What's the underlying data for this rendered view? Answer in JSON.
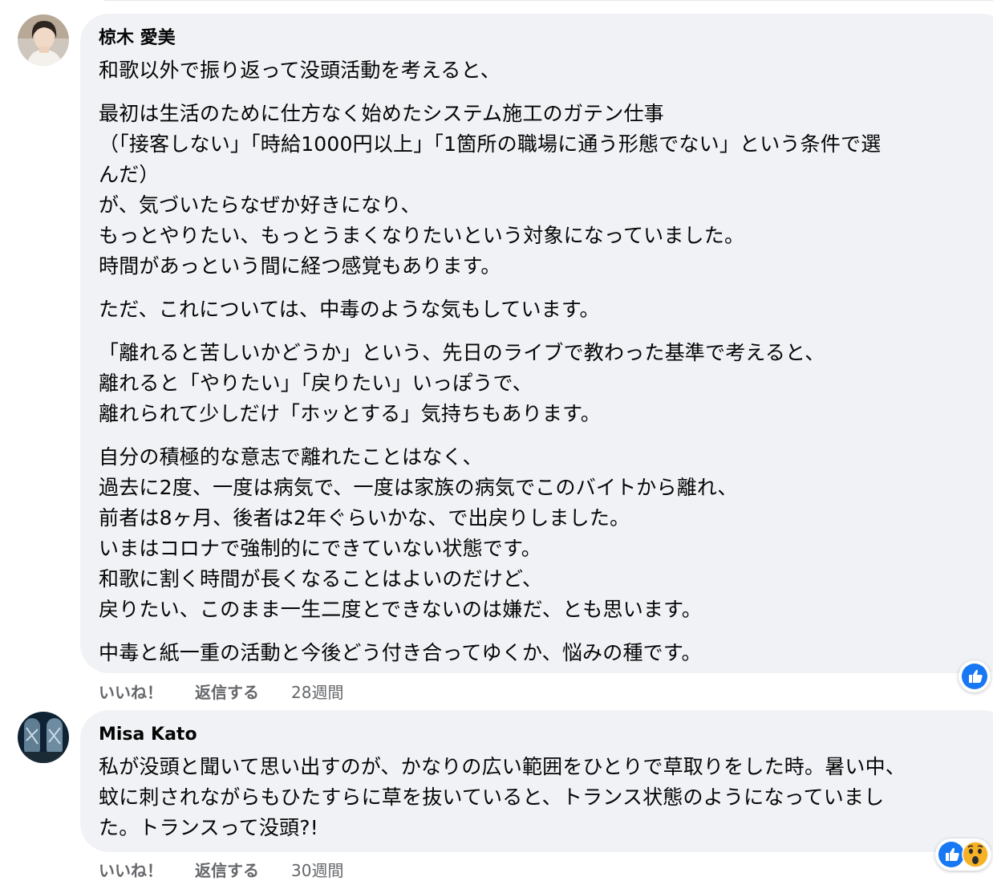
{
  "comments": [
    {
      "author": "椋木 愛美",
      "paragraphs": [
        [
          "和歌以外で振り返って没頭活動を考えると、"
        ],
        [
          "最初は生活のために仕方なく始めたシステム施工のガテン仕事",
          "（「接客しない」「時給1000円以上」「1箇所の職場に通う形態でない」という条件で選",
          "んだ）",
          "が、気づいたらなぜか好きになり、",
          "もっとやりたい、もっとうまくなりたいという対象になっていました。",
          "時間があっという間に経つ感覚もあります。"
        ],
        [
          "ただ、これについては、中毒のような気もしています。"
        ],
        [
          "「離れると苦しいかどうか」という、先日のライブで教わった基準で考えると、",
          "離れると「やりたい」「戻りたい」いっぽうで、",
          "離れられて少しだけ「ホッとする」気持ちもあります。"
        ],
        [
          "自分の積極的な意志で離れたことはなく、",
          "過去に2度、一度は病気で、一度は家族の病気でこのバイトから離れ、",
          "前者は8ヶ月、後者は2年ぐらいかな、で出戻りしました。",
          "いまはコロナで強制的にできていない状態です。",
          "和歌に割く時間が長くなることはよいのだけど、",
          "戻りたい、このまま一生二度とできないのは嫌だ、とも思います。"
        ],
        [
          "中毒と紙一重の活動と今後どう付き合ってゆくか、悩みの種です。"
        ]
      ],
      "like_label": "いいね！",
      "reply_label": "返信する",
      "time": "28週間",
      "reactions": [
        "like-icon"
      ]
    },
    {
      "author": "Misa Kato",
      "paragraphs": [
        [
          "私が没頭と聞いて思い出すのが、かなりの広い範囲をひとりで草取りをした時。暑い中、",
          "蚊に刺されながらもひたすらに草を抜いていると、トランス状態のようになっていまし",
          "た。トランスって没頭?!"
        ]
      ],
      "like_label": "いいね！",
      "reply_label": "返信する",
      "time": "30週間",
      "reactions": [
        "like-icon",
        "wow-icon"
      ]
    }
  ],
  "colors": {
    "bubble_bg": "#f0f2f5",
    "text": "#050505",
    "secondary_text": "#65676b",
    "like_blue": "#1877f2",
    "wow_yellow": "#f7b125"
  }
}
